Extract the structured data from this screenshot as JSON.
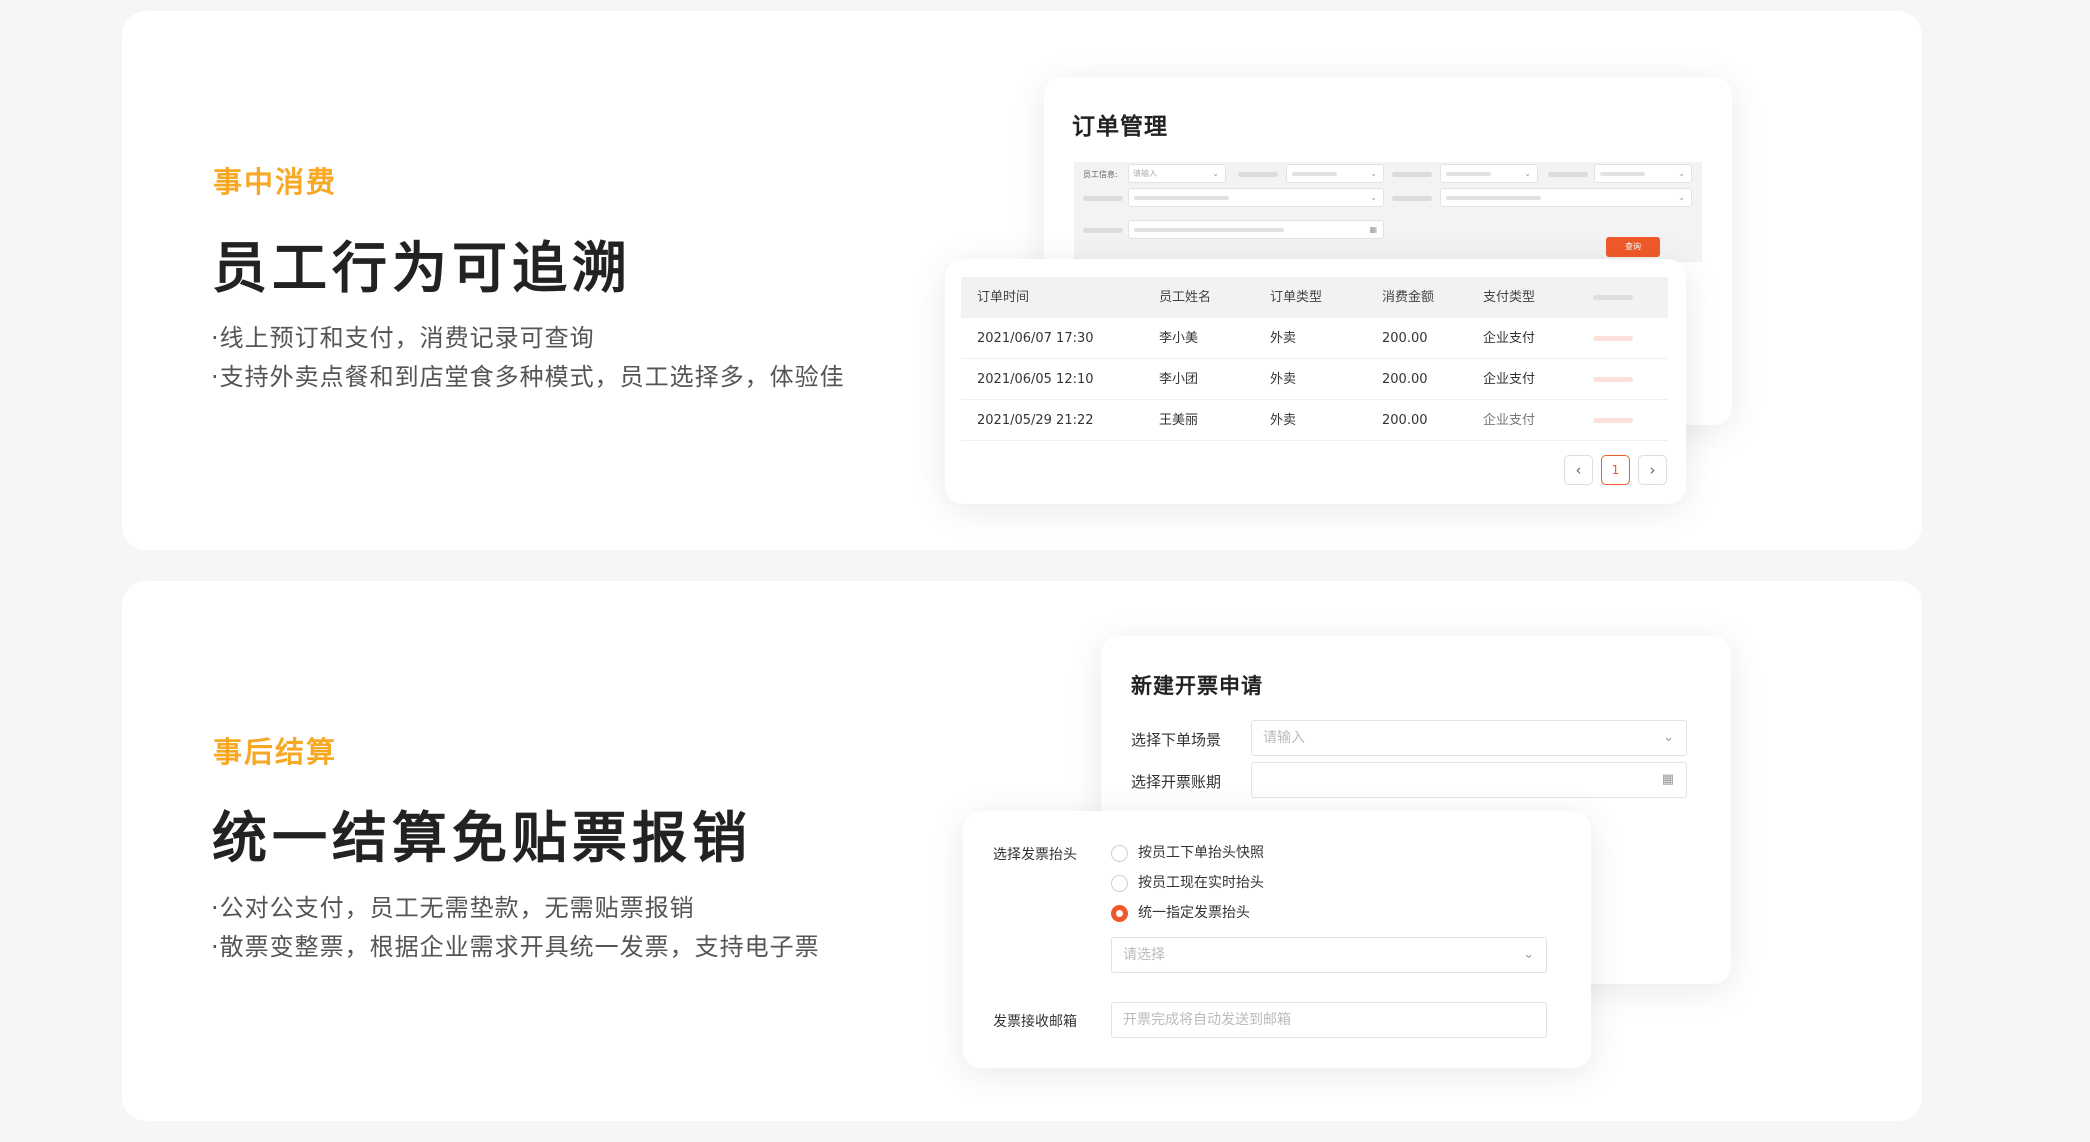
{
  "section1": {
    "eyebrow": "事中消费",
    "headline": "员工行为可追溯",
    "bullets": [
      "·线上预订和支付，消费记录可查询",
      "·支持外卖点餐和到店堂食多种模式，员工选择多，体验佳"
    ],
    "order_card": {
      "title": "订单管理",
      "filter_label": "员工信息:",
      "filter_placeholder": "请输入",
      "query_button": "查询"
    },
    "order_table": {
      "headers": [
        "订单时间",
        "员工姓名",
        "订单类型",
        "消费金额",
        "支付类型"
      ],
      "rows": [
        [
          "2021/06/07 17:30",
          "李小美",
          "外卖",
          "200.00",
          "企业支付"
        ],
        [
          "2021/06/05 12:10",
          "李小团",
          "外卖",
          "200.00",
          "企业支付"
        ],
        [
          "2021/05/29 21:22",
          "王美丽",
          "外卖",
          "200.00",
          "企业支付"
        ]
      ],
      "pagination": {
        "prev": "‹",
        "current": "1",
        "next": "›"
      }
    }
  },
  "section2": {
    "eyebrow": "事后结算",
    "headline": "统一结算免贴票报销",
    "bullets": [
      "·公对公支付，员工无需垫款，无需贴票报销",
      "·散票变整票，根据企业需求开具统一发票，支持电子票"
    ],
    "invoice_card": {
      "title": "新建开票申请",
      "scene_label": "选择下单场景",
      "scene_placeholder": "请输入",
      "period_label": "选择开票账期"
    },
    "invoice_header_card": {
      "label": "选择发票抬头",
      "options": [
        "按员工下单抬头快照",
        "按员工现在实时抬头",
        "统一指定发票抬头"
      ],
      "selected_index": 2,
      "select_placeholder": "请选择",
      "email_label": "发票接收邮箱",
      "email_placeholder": "开票完成将自动发送到邮箱"
    }
  },
  "colors": {
    "eyebrow": "#f7a825",
    "accent": "#f05a2a",
    "background": "#f6f6f6"
  }
}
